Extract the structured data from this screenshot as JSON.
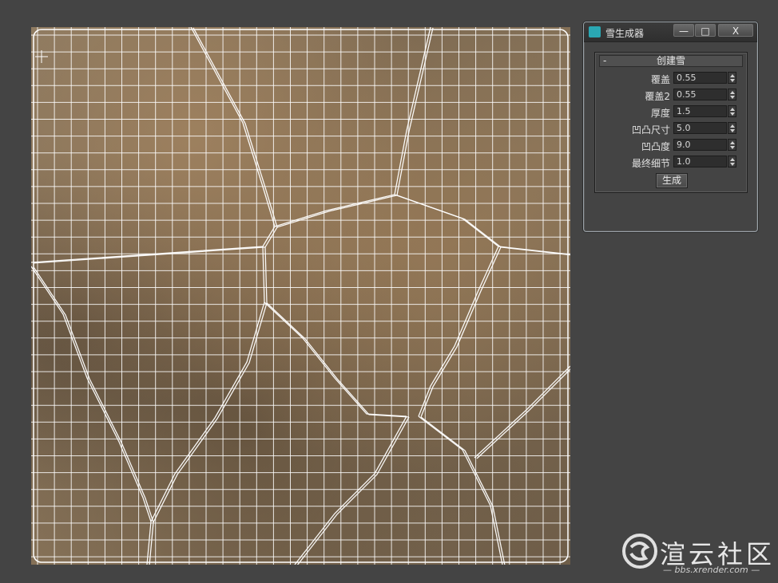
{
  "dialog": {
    "title": "雪生成器",
    "icon": "3ds-max-icon",
    "controls": {
      "minimize": "—",
      "maximize": "□",
      "close": "X"
    },
    "rollout": {
      "toggle": "-",
      "title": "创建雪",
      "params": [
        {
          "label": "覆盖",
          "value": "0.55"
        },
        {
          "label": "覆盖2",
          "value": "0.55"
        },
        {
          "label": "厚度",
          "value": "1.5"
        },
        {
          "label": "凹凸尺寸",
          "value": "5.0"
        },
        {
          "label": "凹凸度",
          "value": "9.0"
        },
        {
          "label": "最终细节",
          "value": "1.0"
        }
      ],
      "generate_label": "生成"
    }
  },
  "viewport": {
    "content": "stone-texture-mesh",
    "wire_color": "#ffffff"
  },
  "watermark": {
    "text": "渲云社区",
    "url": "— bbs.xrender.com —"
  }
}
